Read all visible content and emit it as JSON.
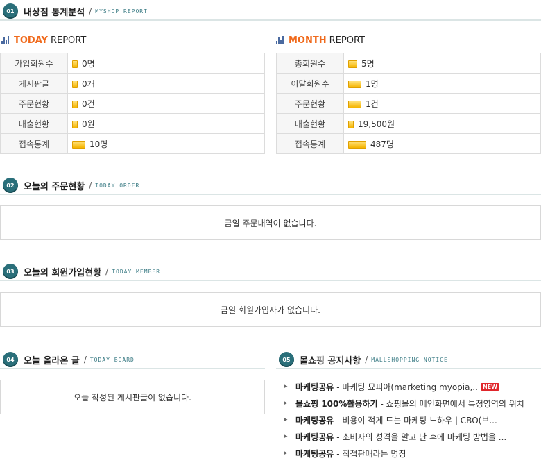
{
  "sections": {
    "s1": {
      "num": "01",
      "title": "내상점 통계분석",
      "en": "MYSHOP REPORT"
    },
    "s2": {
      "num": "02",
      "title": "오늘의 주문현황",
      "en": "TODAY ORDER"
    },
    "s3": {
      "num": "03",
      "title": "오늘의 회원가입현황",
      "en": "TODAY MEMBER"
    },
    "s4": {
      "num": "04",
      "title": "오늘 올라온 글",
      "en": "TODAY BOARD"
    },
    "s5": {
      "num": "05",
      "title": "몰쇼핑 공지사항",
      "en": "MALLSHOPPING NOTICE"
    }
  },
  "today": {
    "accent": "TODAY",
    "rest": "REPORT",
    "rows": [
      {
        "label": "가입회원수",
        "value": "0명",
        "level": 0.05
      },
      {
        "label": "게시판글",
        "value": "0개",
        "level": 0.05
      },
      {
        "label": "주문현황",
        "value": "0건",
        "level": 0.05
      },
      {
        "label": "매출현황",
        "value": "0원",
        "level": 0.05
      },
      {
        "label": "접속통계",
        "value": "10명",
        "level": 0.12
      }
    ]
  },
  "month": {
    "accent": "MONTH",
    "rest": "REPORT",
    "rows": [
      {
        "label": "총회원수",
        "value": "5명",
        "level": 0.08
      },
      {
        "label": "이달회원수",
        "value": "1명",
        "level": 0.12
      },
      {
        "label": "주문현황",
        "value": "1건",
        "level": 0.12
      },
      {
        "label": "매출현황",
        "value": "19,500원",
        "level": 0.05
      },
      {
        "label": "접속통계",
        "value": "487명",
        "level": 0.16
      }
    ]
  },
  "empty": {
    "order": "금일 주문내역이 없습니다.",
    "member": "금일 회원가입자가 없습니다.",
    "board": "오늘 작성된 게시판글이 없습니다."
  },
  "notices": [
    {
      "cat": "마케팅공유",
      "text": "- 마케팅 묘피아(marketing myopia,..",
      "new": "NEW"
    },
    {
      "cat": "몰쇼핑 100%활용하기",
      "text": "- 쇼핑몰의 메인화면에서 특정영역의 위치",
      "new": ""
    },
    {
      "cat": "마케팅공유",
      "text": "- 비용이 적게 드는 마케팅 노하우 | CBO(브...",
      "new": ""
    },
    {
      "cat": "마케팅공유",
      "text": "- 소비자의 성격을 알고 난 후에 마케팅 방법을 ...",
      "new": ""
    },
    {
      "cat": "마케팅공유",
      "text": "- 직접판매라는 명칭",
      "new": ""
    }
  ],
  "colors": {
    "accent": "#f06a1c",
    "badge": "#2a6f7a",
    "bar": "#f5b400"
  }
}
